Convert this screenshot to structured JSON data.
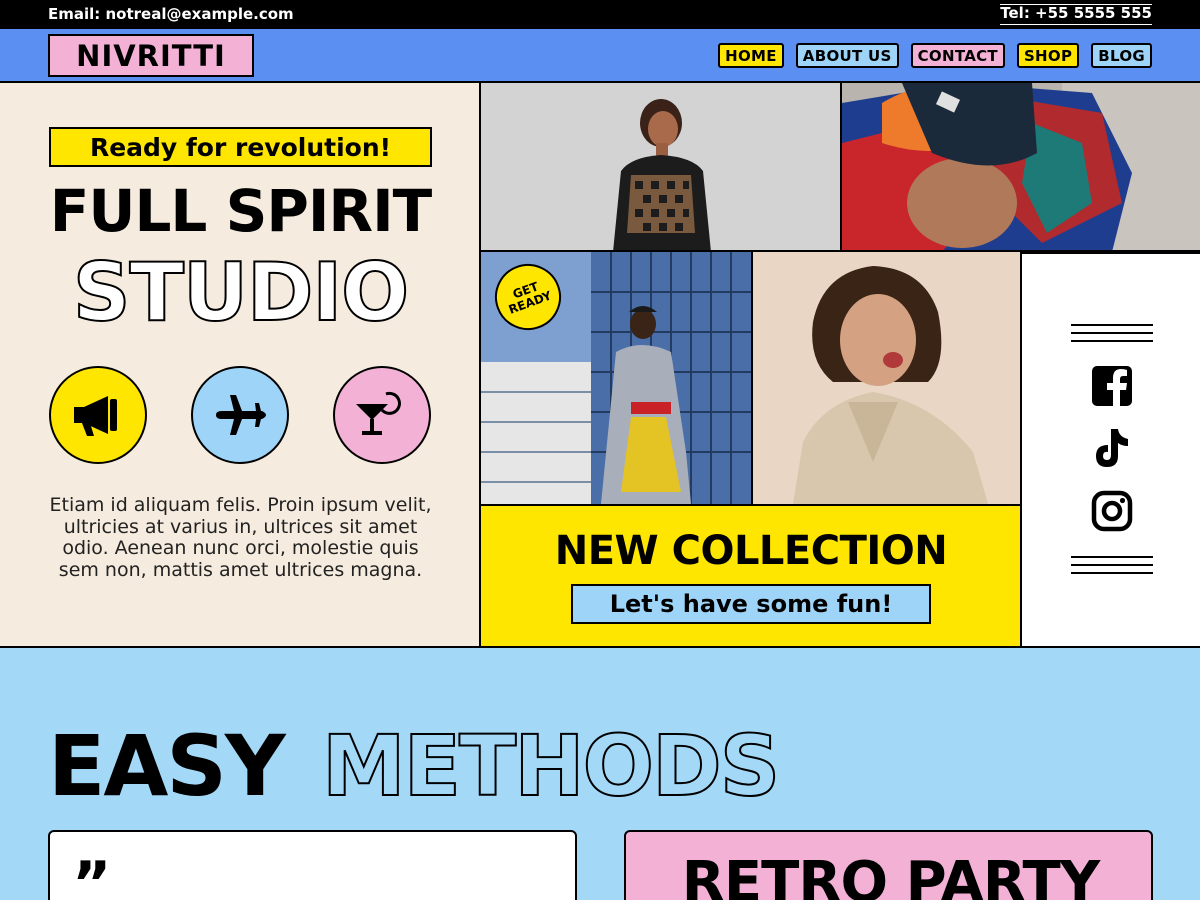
{
  "topbar": {
    "email": "Email: notreal@example.com",
    "phone": "Tel: +55 5555 555"
  },
  "brand": {
    "logo": "NIVRITTI"
  },
  "nav": [
    {
      "label": "HOME",
      "color": "#ffe600"
    },
    {
      "label": "ABOUT US",
      "color": "#9dd4f7"
    },
    {
      "label": "CONTACT",
      "color": "#f3b1d6"
    },
    {
      "label": "SHOP",
      "color": "#ffe600"
    },
    {
      "label": "BLOG",
      "color": "#9dd4f7"
    }
  ],
  "hero": {
    "tagline": "Ready for revolution!",
    "title_line1": "FULL SPIRIT",
    "title_line2": "STUDIO",
    "icons": [
      {
        "name": "megaphone-icon",
        "color": "#ffe600"
      },
      {
        "name": "airplane-icon",
        "color": "#9dd4f7"
      },
      {
        "name": "cocktail-icon",
        "color": "#f3b1d6"
      }
    ],
    "body": "Etiam id aliquam felis. Proin ipsum velit, ultricies at varius in, ultrices sit amet odio. Aenean nunc orci, molestie quis sem non, mattis amet ultrices magna."
  },
  "badge": {
    "line1": "GET",
    "line2": "READY"
  },
  "collection": {
    "title": "NEW COLLECTION",
    "subtitle": "Let's have some fun!"
  },
  "social": {
    "icons": [
      "facebook-icon",
      "tiktok-icon",
      "instagram-icon"
    ]
  },
  "methods": {
    "word1": "EASY",
    "word2": "METHODS"
  },
  "cards": {
    "quote_mark": "”",
    "retro_title": "RETRO PARTY"
  },
  "colors": {
    "yellow": "#ffe600",
    "blue": "#9dd4f7",
    "pink": "#f3b1d6",
    "nav_blue": "#5b8ff1",
    "cream": "#f5ebde",
    "sky": "#a3d8f7"
  }
}
